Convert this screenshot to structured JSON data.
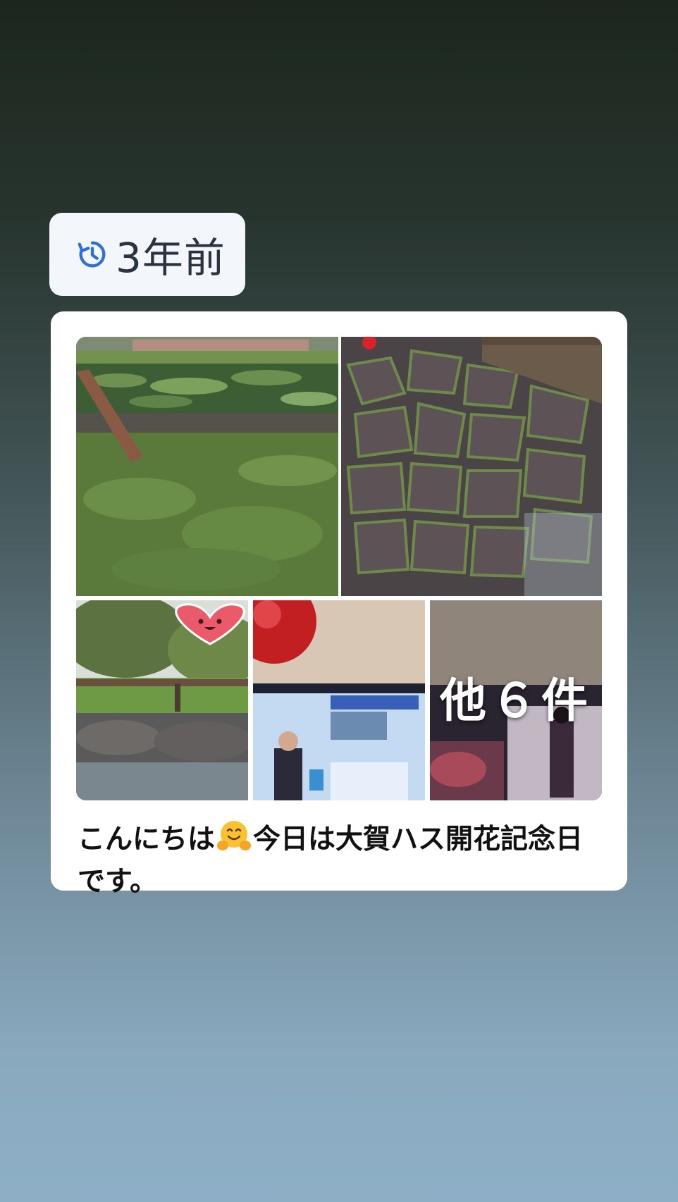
{
  "memory": {
    "badge_label": "3年前",
    "icon": "history-icon",
    "accent_color": "#2f6fd6"
  },
  "post": {
    "photos": [
      {
        "name": "photo-lotus-pond"
      },
      {
        "name": "photo-mossy-stone-path"
      },
      {
        "name": "photo-park-fence-heart"
      },
      {
        "name": "photo-tv-news-broadcast"
      },
      {
        "name": "photo-more-thumbnail"
      }
    ],
    "more_label": "他６件",
    "caption_before": "こんにちは",
    "caption_emoji": "hugging-face-emoji",
    "caption_after": "今日は大賀ハス開花記念日です。"
  }
}
